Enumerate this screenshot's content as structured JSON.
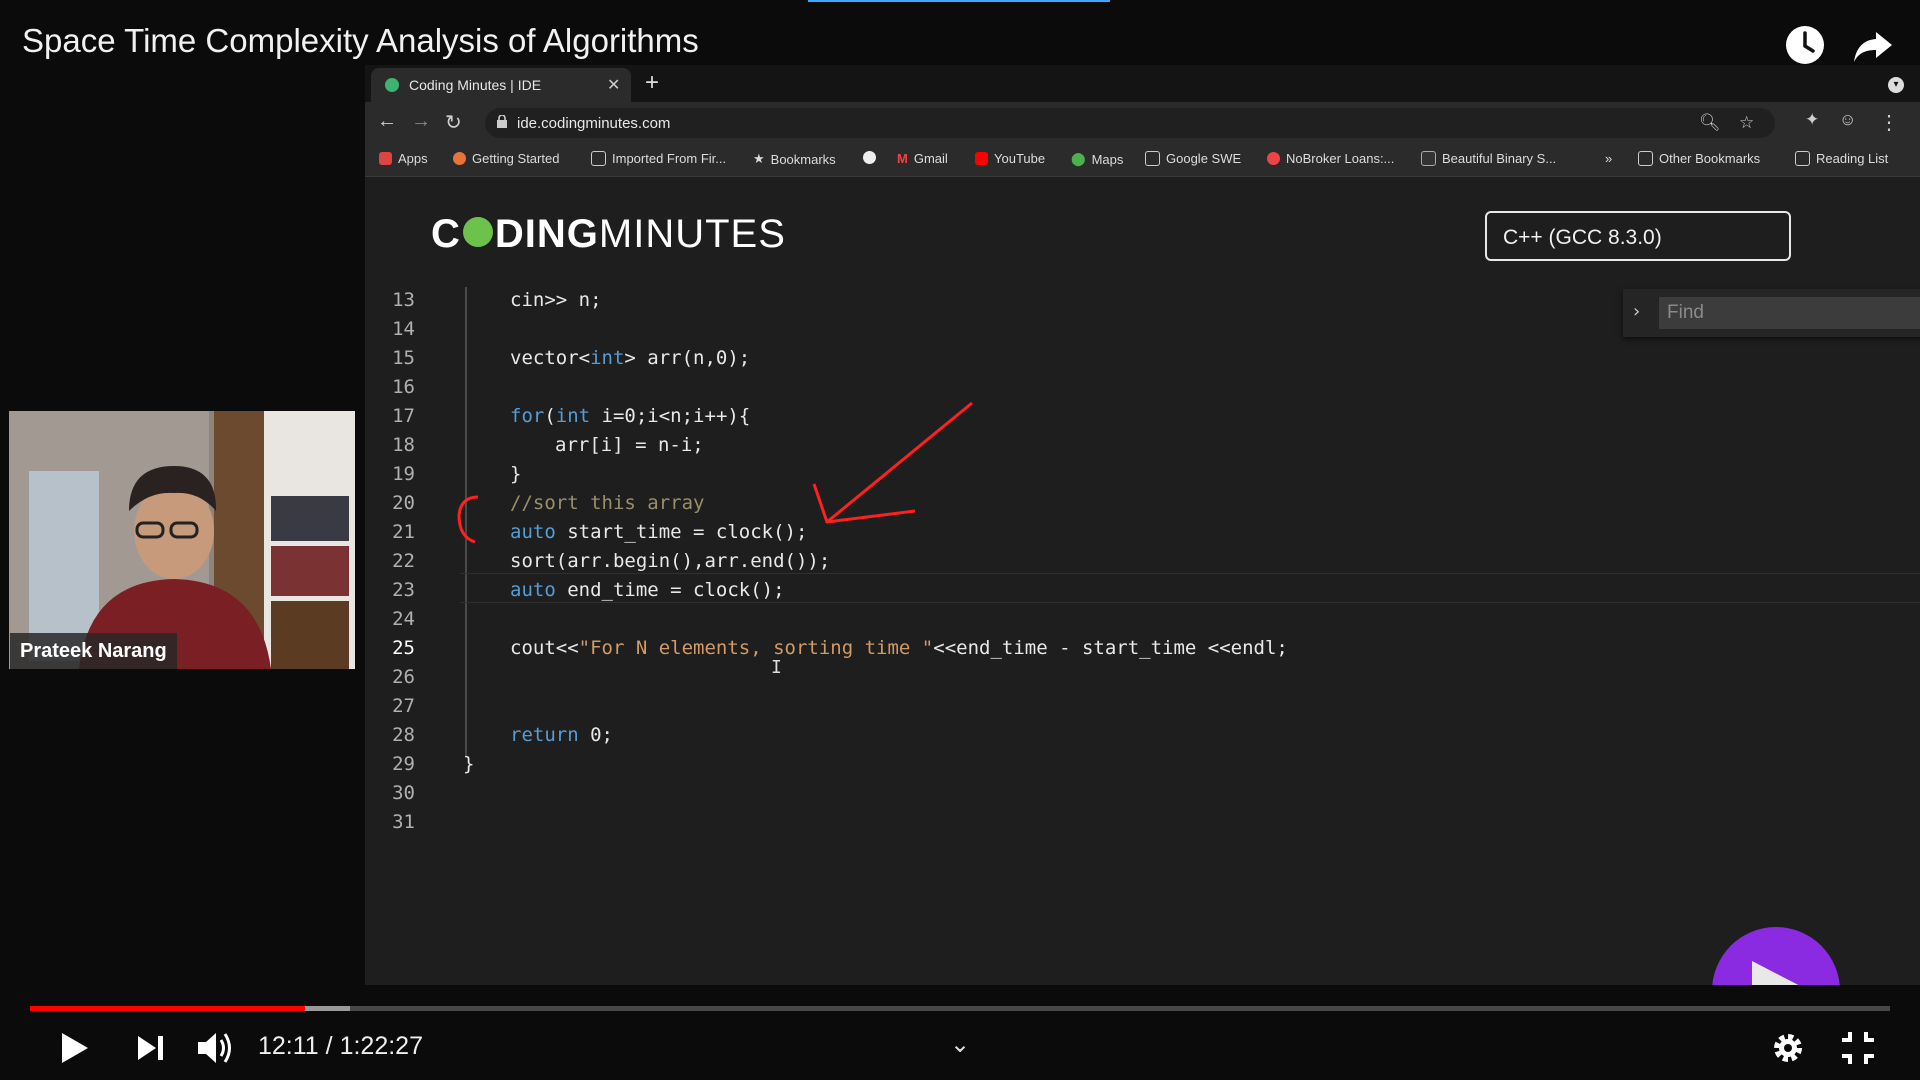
{
  "video": {
    "title": "Space Time Complexity Analysis of Algorithms",
    "current_time": "12:11",
    "separator": " / ",
    "duration": "1:22:27",
    "played_fraction": 0.148,
    "buffered_fraction": 0.172
  },
  "browser": {
    "tab_title": "Coding Minutes | IDE",
    "url": "ide.codingminutes.com",
    "bookmarks": [
      "Apps",
      "Getting Started",
      "Imported From Fir...",
      "Bookmarks",
      "",
      "Gmail",
      "YouTube",
      "Maps",
      "Google SWE",
      "NoBroker Loans:...",
      "Beautiful Binary S...",
      "»",
      "Other Bookmarks",
      "Reading List"
    ]
  },
  "ide": {
    "logo_bold_1": "C",
    "logo_bold_2": "DING",
    "logo_light": "MINUTES",
    "language": "C++ (GCC 8.3.0)",
    "find_placeholder": "Find",
    "line_numbers": [
      "13",
      "14",
      "15",
      "16",
      "17",
      "18",
      "19",
      "20",
      "21",
      "22",
      "23",
      "24",
      "25",
      "26",
      "27",
      "28",
      "29",
      "30",
      "31"
    ],
    "active_line": "25"
  },
  "presenter": {
    "name": "Prateek Narang"
  },
  "colors": {
    "accent_red": "#ff0000",
    "run_button": "#8a2be2",
    "keyword": "#569cd6"
  }
}
